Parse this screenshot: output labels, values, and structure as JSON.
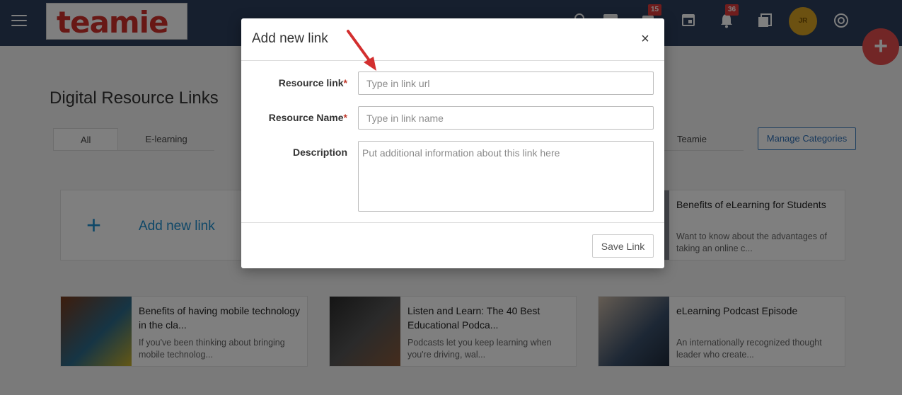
{
  "app": {
    "logo_text": "teamie",
    "avatar_initials": "JR"
  },
  "topbar": {
    "badges": {
      "messages": "15",
      "notifications": "36"
    },
    "icons": [
      "menu-icon",
      "search-icon",
      "chat-icon",
      "calendar-icon",
      "bell-icon",
      "document-icon",
      "help-icon"
    ]
  },
  "fab_label": "+",
  "page": {
    "title": "Digital Resource Links",
    "tabs": [
      "All",
      "E-learning",
      "Teamie"
    ],
    "manage_label": "Manage Categories",
    "add_card_plus": "+",
    "add_card_label": "Add new link",
    "cards": [
      {
        "title": "Benefits of eLearning for Students",
        "desc": "Want to know about the advantages of taking an online c..."
      },
      {
        "title": "Benefits of having mobile technology in the cla...",
        "desc": "If you've been thinking about bringing mobile technolog..."
      },
      {
        "title": "Listen and Learn: The 40 Best Educational Podca...",
        "desc": "Podcasts let you keep learning when you're driving, wal..."
      },
      {
        "title": "eLearning Podcast Episode",
        "desc": "An internationally recognized thought leader who create..."
      }
    ]
  },
  "modal": {
    "title": "Add new link",
    "close_symbol": "×",
    "fields": {
      "resource_link": {
        "label": "Resource link",
        "required": "*",
        "placeholder": "Type in link url"
      },
      "resource_name": {
        "label": "Resource Name",
        "required": "*",
        "placeholder": "Type in link name"
      },
      "description": {
        "label": "Description",
        "placeholder": "Put additional information about this link here"
      }
    },
    "save_label": "Save Link"
  },
  "colors": {
    "topbar": "#2c3e5c",
    "accent": "#1c8ed0",
    "logo": "#d0302b",
    "fab": "#e44c4c",
    "arrow": "#d32f2f"
  }
}
